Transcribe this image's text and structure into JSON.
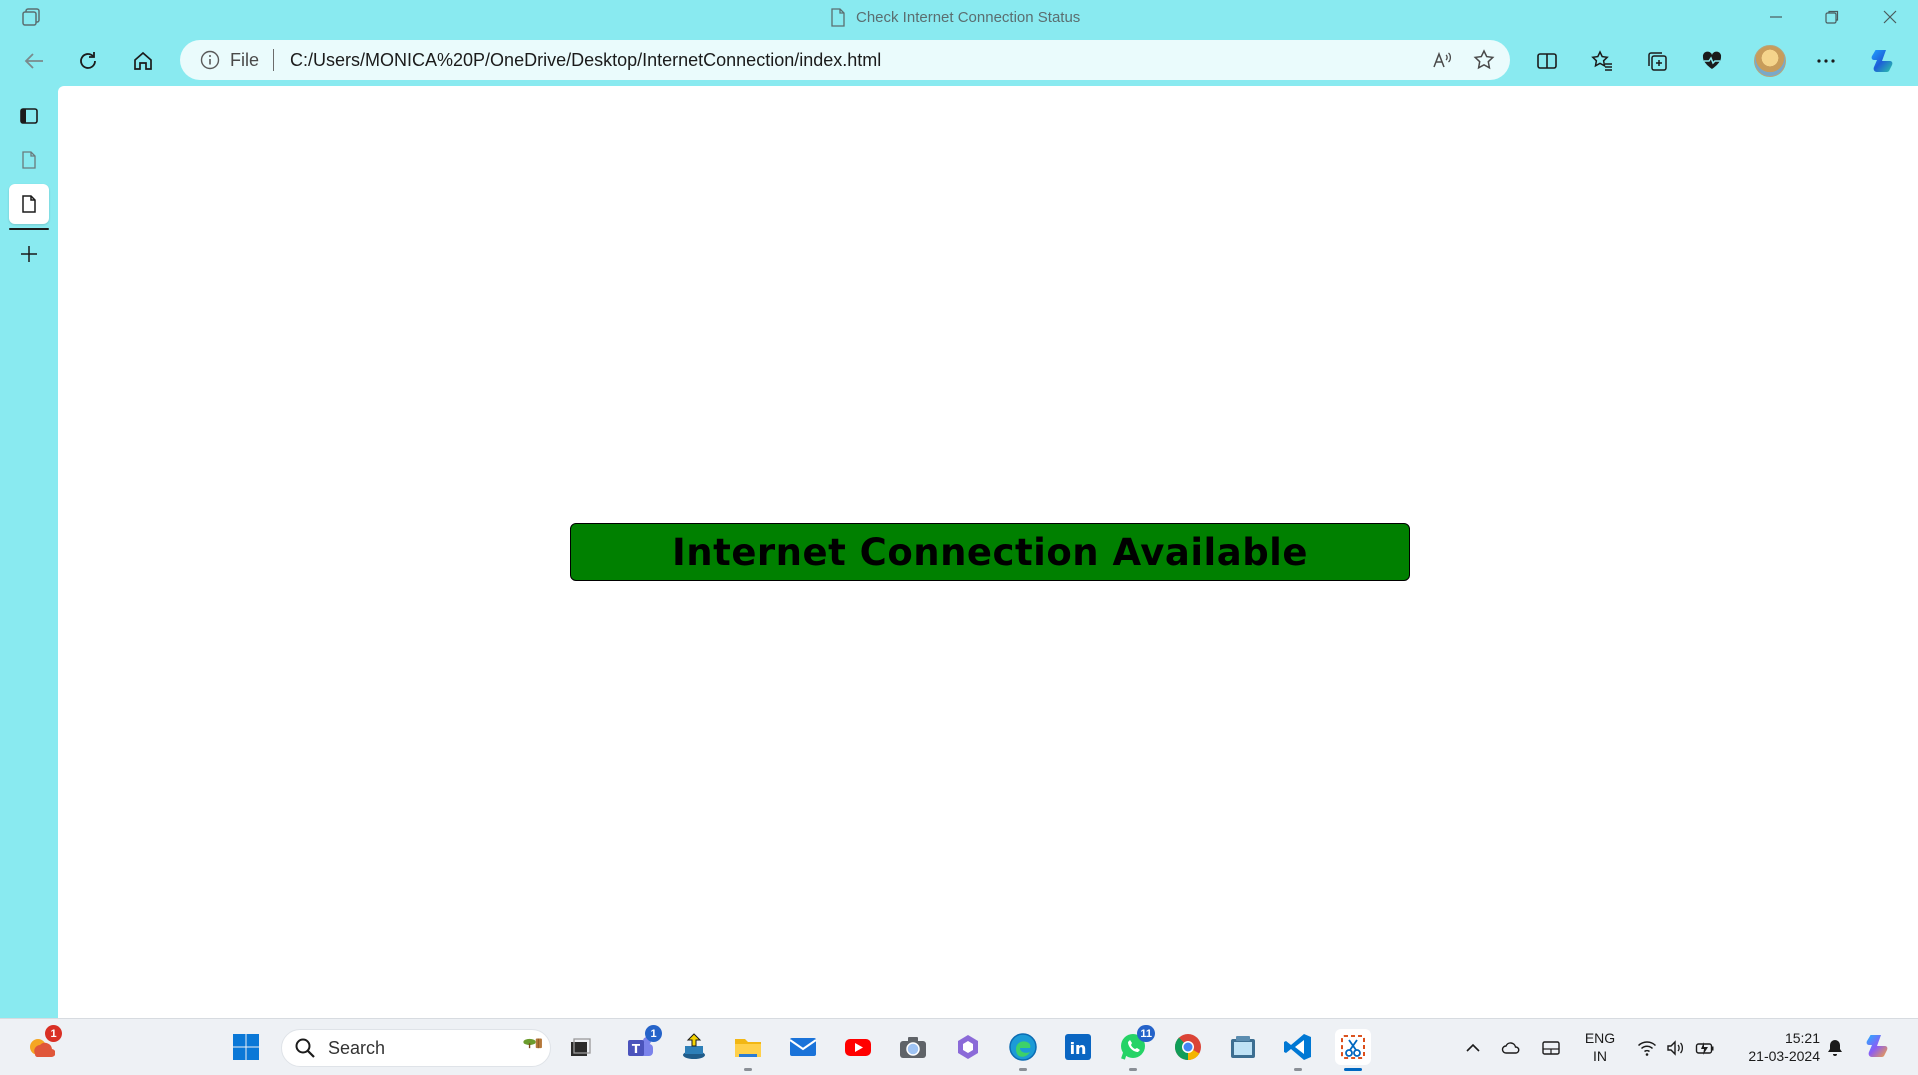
{
  "window": {
    "title": "Check Internet Connection Status"
  },
  "address_bar": {
    "scheme_label": "File",
    "url": "C:/Users/MONICA%20P/OneDrive/Desktop/InternetConnection/index.html"
  },
  "page": {
    "status_message": "Internet Connection Available",
    "status_color": "#008000"
  },
  "taskbar": {
    "search_label": "Search",
    "weather_badge": "1",
    "teams_badge": "1",
    "whatsapp_badge": "11",
    "apps": [
      "widgets-icon",
      "start-icon",
      "search",
      "task-view-icon",
      "teams-icon",
      "installer-icon",
      "file-explorer-icon",
      "mail-icon",
      "youtube-icon",
      "camera-icon",
      "copilot-app-icon",
      "edge-icon",
      "linkedin-icon",
      "whatsapp-icon",
      "chrome-icon",
      "clipboard-icon",
      "vscode-icon",
      "snipping-tool-icon"
    ]
  },
  "tray": {
    "language_line1": "ENG",
    "language_line2": "IN",
    "time": "15:21",
    "date": "21-03-2024"
  },
  "colors": {
    "frame": "#89eaf0",
    "content_bg": "#ffffff",
    "taskbar_bg": "#eef1f5"
  }
}
